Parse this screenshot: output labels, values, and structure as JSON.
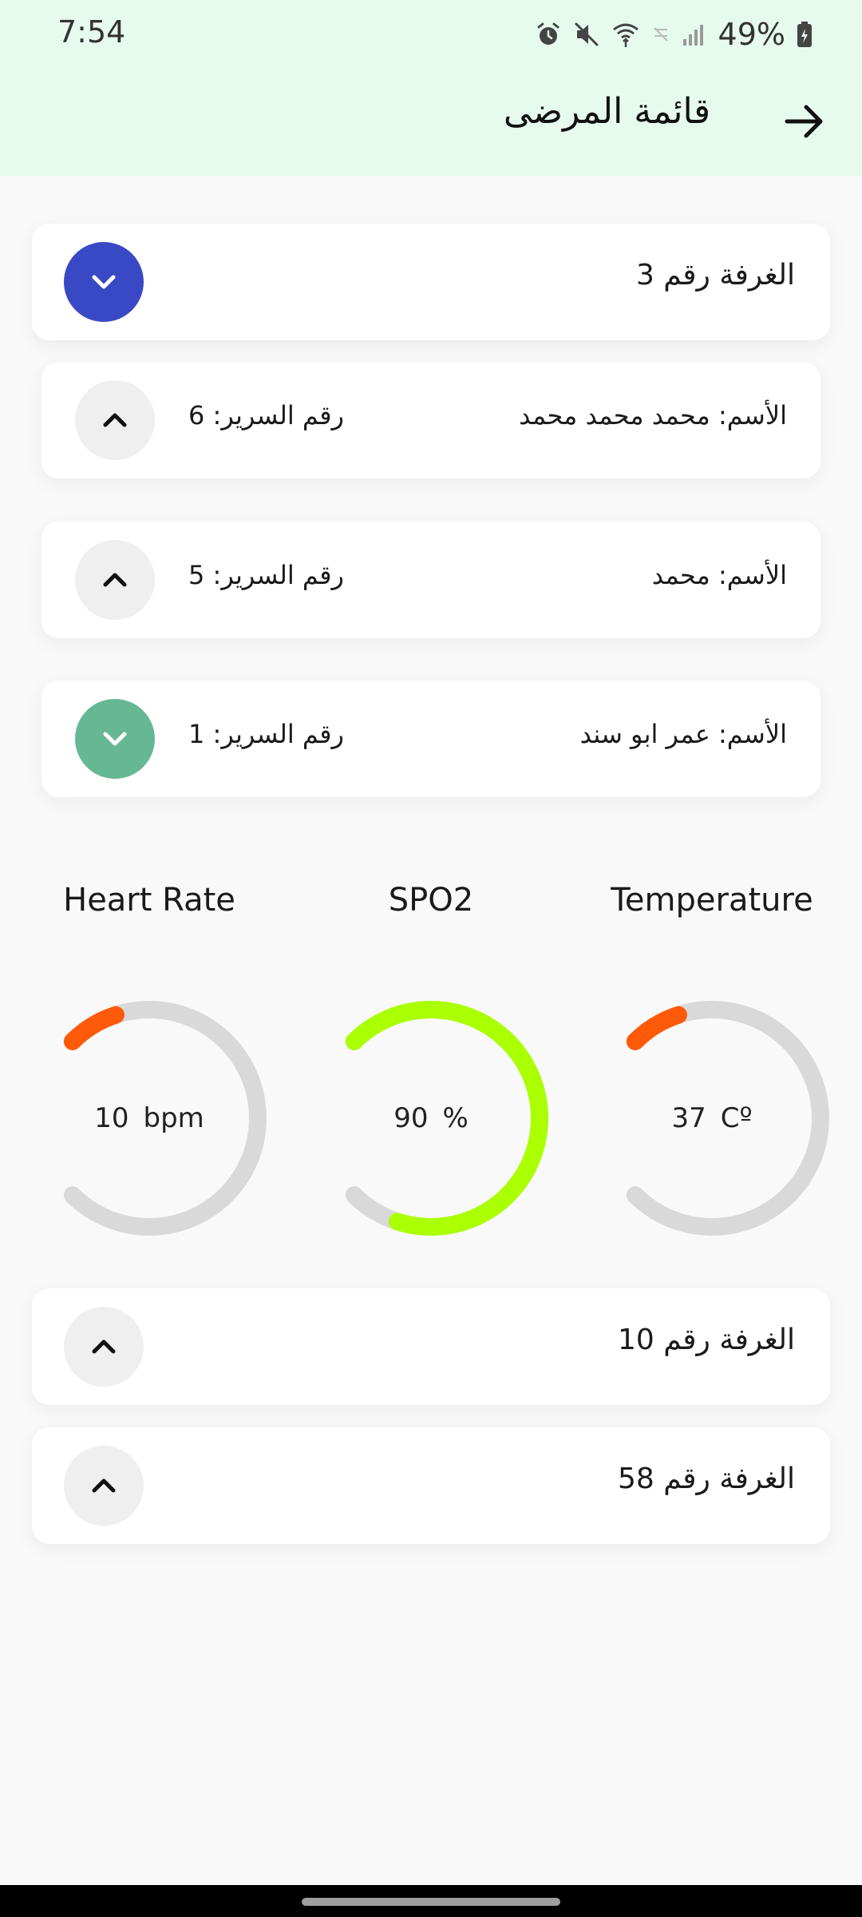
{
  "status_bar": {
    "time": "7:54",
    "battery": "49%"
  },
  "app_bar": {
    "title": "قائمة المرضى",
    "back_icon": "arrow-right-icon"
  },
  "rooms": [
    {
      "label": "الغرفة رقم 3",
      "expanded": true,
      "patients": [
        {
          "name": "الأسم: محمد محمد محمد",
          "bed": "رقم السرير: 6",
          "expanded": false
        },
        {
          "name": "الأسم: محمد",
          "bed": "رقم السرير: 5",
          "expanded": false
        },
        {
          "name": "الأسم: عمر ابو سند",
          "bed": "رقم السرير: 1",
          "expanded": true
        }
      ]
    },
    {
      "label": "الغرفة رقم 10",
      "expanded": false
    },
    {
      "label": "الغرفة رقم 58",
      "expanded": false
    }
  ],
  "vitals": {
    "heart_rate": {
      "title": "Heart Rate",
      "value": "10",
      "unit": "bpm",
      "color": "#ff5a0a",
      "fill_fraction": 0.1
    },
    "spo2": {
      "title": "SPO2",
      "value": "90",
      "unit": "%",
      "color": "#aaff00",
      "fill_fraction": 0.9
    },
    "temperature": {
      "title": "Temperature",
      "value": "37",
      "unit": "Cº",
      "color": "#ff5a0a",
      "fill_fraction": 0.1
    }
  },
  "colors": {
    "app_bar_bg": "#e6fbee",
    "room_expanded_button": "#3949c6",
    "patient_expanded_button": "#66b894",
    "collapsed_button": "#efefef",
    "gauge_track": "#d9d9d9"
  }
}
